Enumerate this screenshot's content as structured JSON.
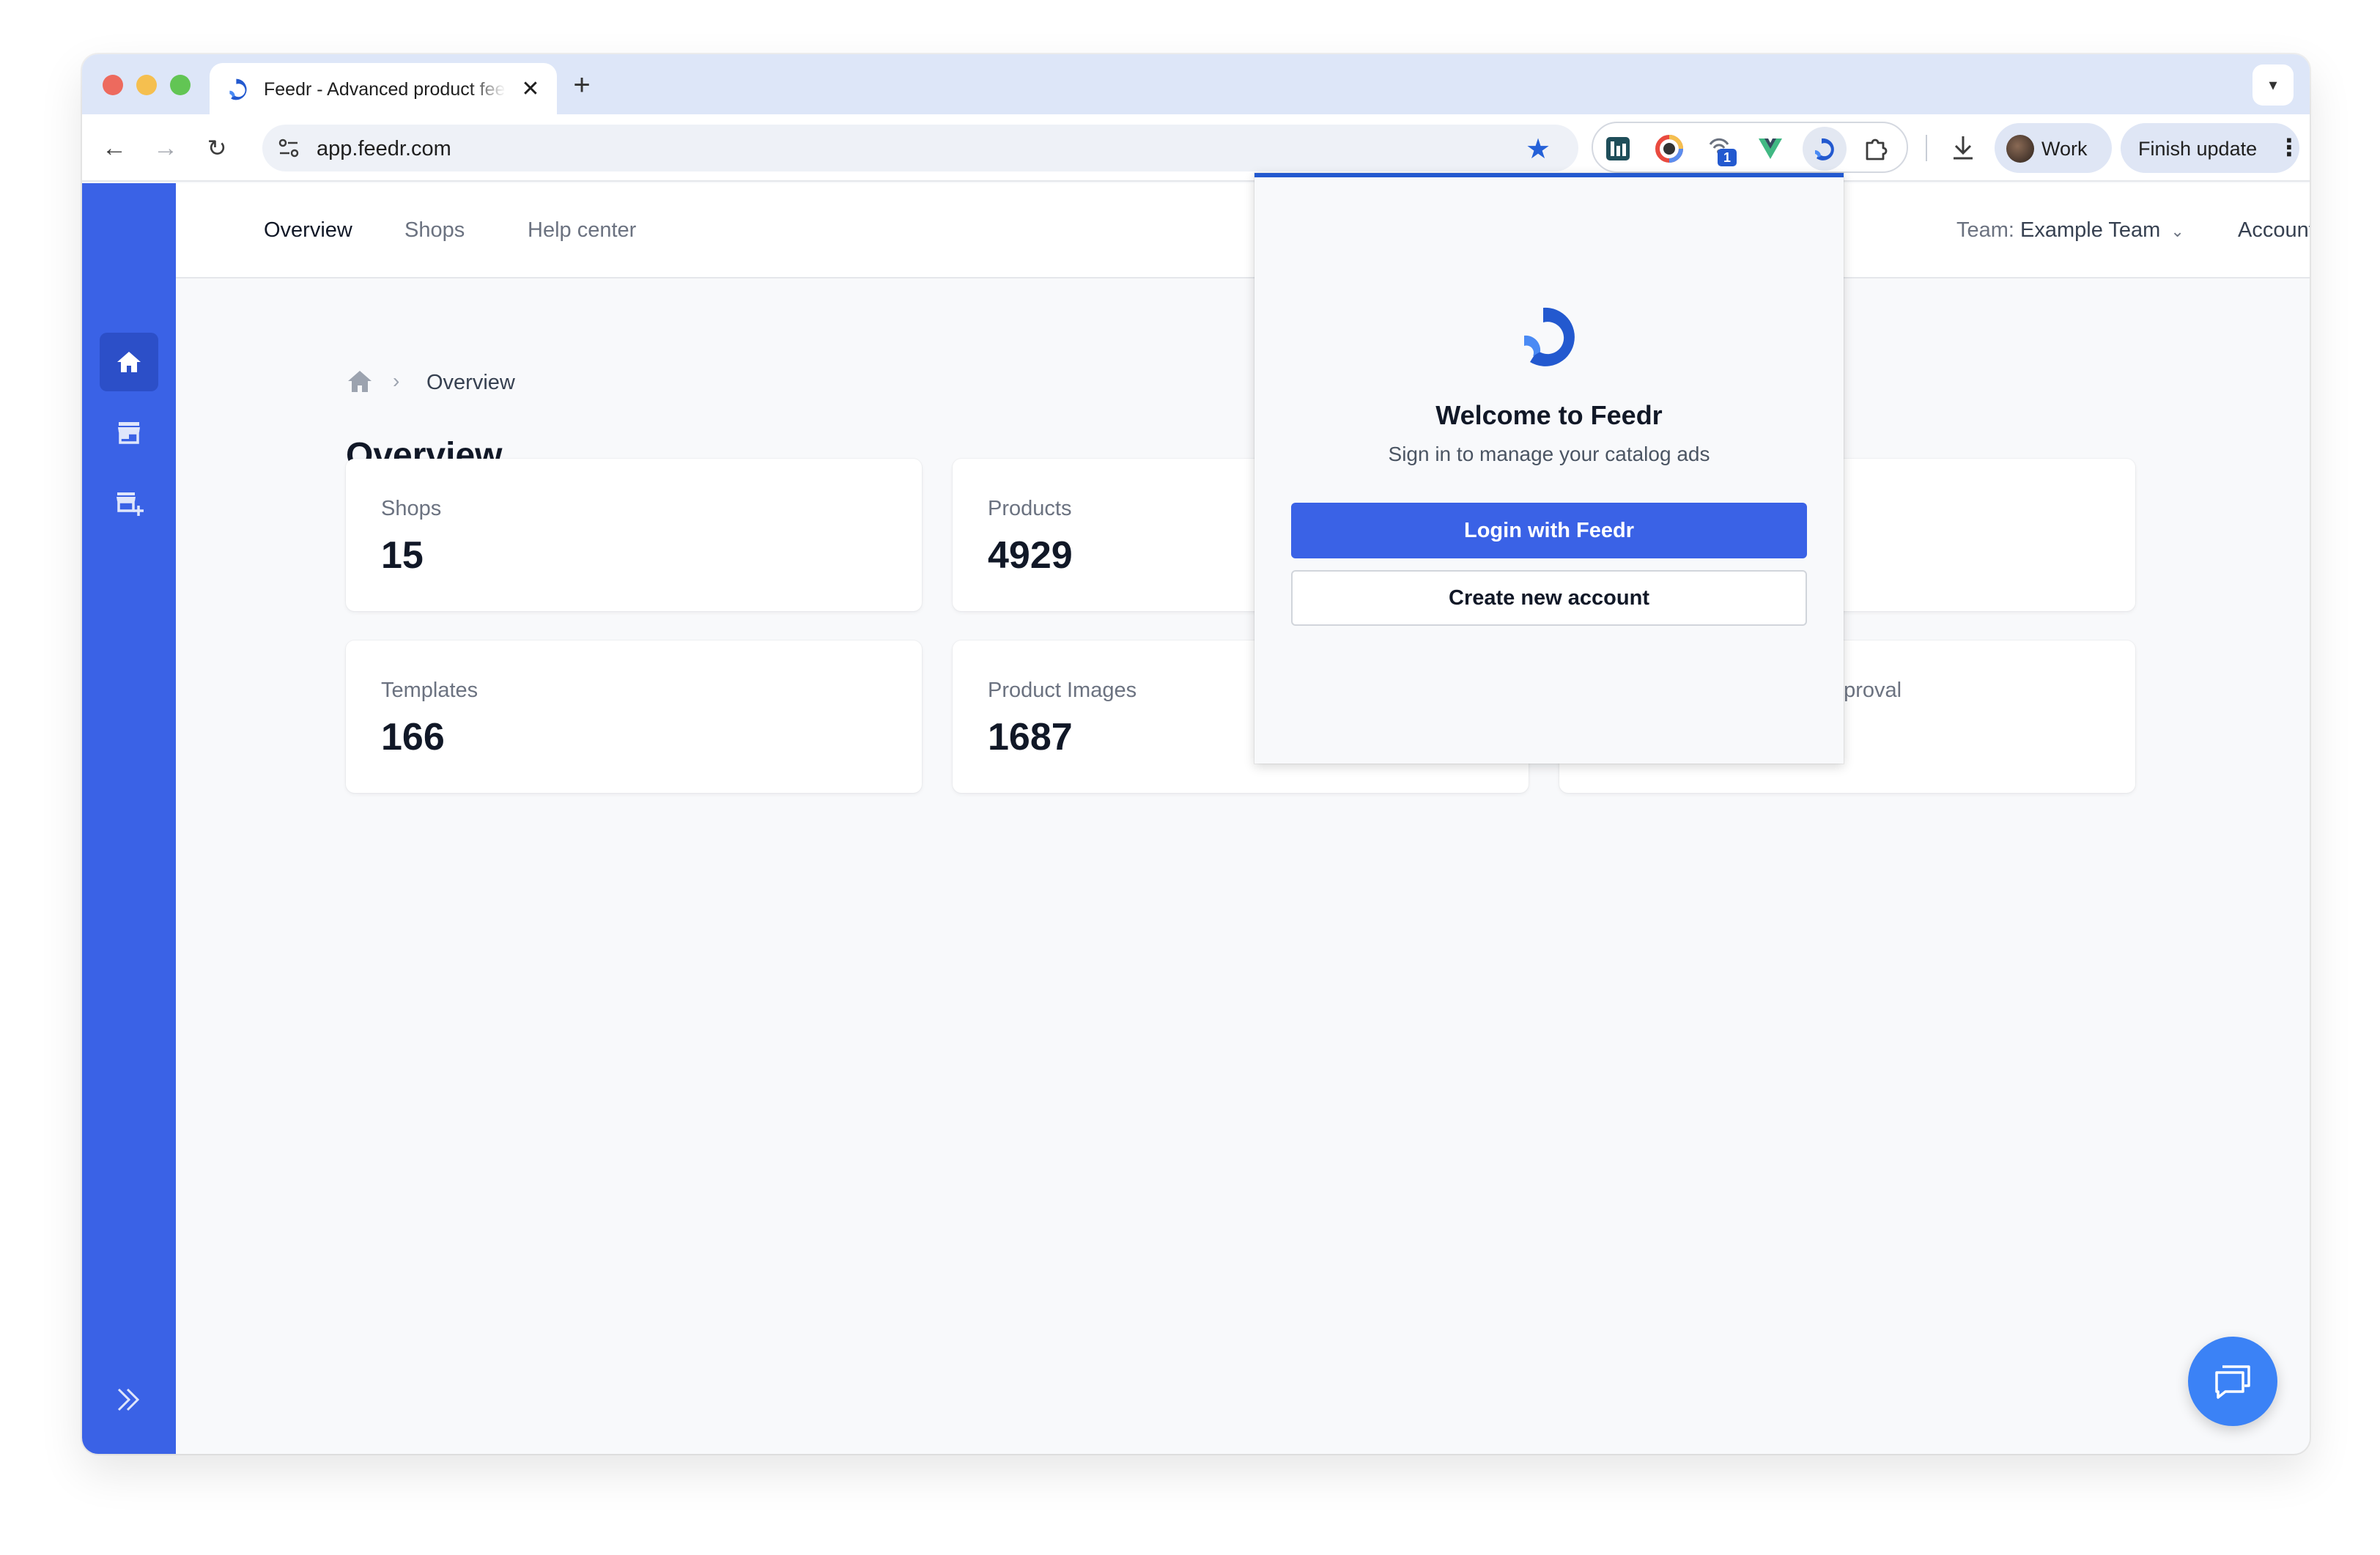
{
  "browser": {
    "tab_title": "Feedr - Advanced product feeds",
    "tab_close": "✕",
    "new_tab": "+",
    "url": "app.feedr.com",
    "extension_badge": "1",
    "profile_label": "Work",
    "finish_update_label": "Finish update"
  },
  "topnav": {
    "links": [
      "Overview",
      "Shops",
      "Help center"
    ],
    "team_prefix": "Team:",
    "team_name": "Example Team",
    "account_label": "Account"
  },
  "breadcrumb": {
    "current": "Overview"
  },
  "page": {
    "title": "Overview"
  },
  "stats": [
    {
      "label": "Shops",
      "value": "15"
    },
    {
      "label": "Products",
      "value": "4929"
    },
    {
      "label": "",
      "value": ""
    },
    {
      "label": "Templates",
      "value": "166"
    },
    {
      "label": "Product Images",
      "value": "1687"
    },
    {
      "label": "pproval",
      "value": ""
    }
  ],
  "popup": {
    "title": "Welcome to Feedr",
    "subtitle": "Sign in to manage your catalog ads",
    "login_label": "Login with Feedr",
    "create_label": "Create new account"
  },
  "colors": {
    "brand_blue": "#3a62e6",
    "sidebar_active": "#2c4fc8",
    "chat_button": "#3b82f6"
  },
  "icons": {
    "sidebar": [
      "home-icon",
      "store-icon",
      "store-add-icon",
      "expand-icon"
    ],
    "chat": "chat-icon"
  }
}
